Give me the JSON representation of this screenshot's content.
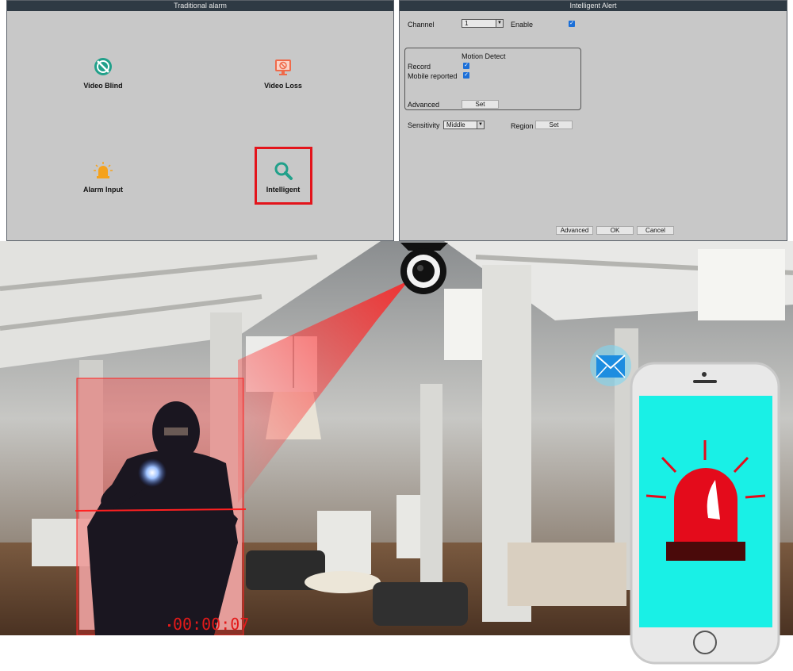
{
  "traditional_alarm": {
    "title": "Traditional alarm",
    "items": [
      {
        "label": "Video Blind",
        "icon": "video-blind-icon"
      },
      {
        "label": "Video Loss",
        "icon": "video-loss-icon"
      },
      {
        "label": "Alarm Input",
        "icon": "alarm-light-icon"
      },
      {
        "label": "Intelligent",
        "icon": "magnifier-icon",
        "selected": true
      }
    ]
  },
  "intelligent_alert": {
    "title": "Intelligent Alert",
    "channel_label": "Channel",
    "channel_value": "1",
    "enable_label": "Enable",
    "enable_checked": true,
    "group_title": "Motion Detect",
    "record_label": "Record",
    "record_checked": true,
    "mobile_label": "Mobile reported",
    "mobile_checked": true,
    "advanced_label": "Advanced",
    "set_label": "Set",
    "sensitivity_label": "Sensitivity",
    "sensitivity_value": "Middle",
    "region_label": "Region",
    "region_set_label": "Set",
    "footer_advanced": "Advanced",
    "footer_ok": "OK",
    "footer_cancel": "Cancel"
  },
  "scene": {
    "timer": "00:00:07"
  },
  "colors": {
    "accent_teal": "#21a08a",
    "alert_red": "#e3141b",
    "phone_screen": "#19f0e6",
    "checkbox_blue": "#1b6fd8"
  }
}
